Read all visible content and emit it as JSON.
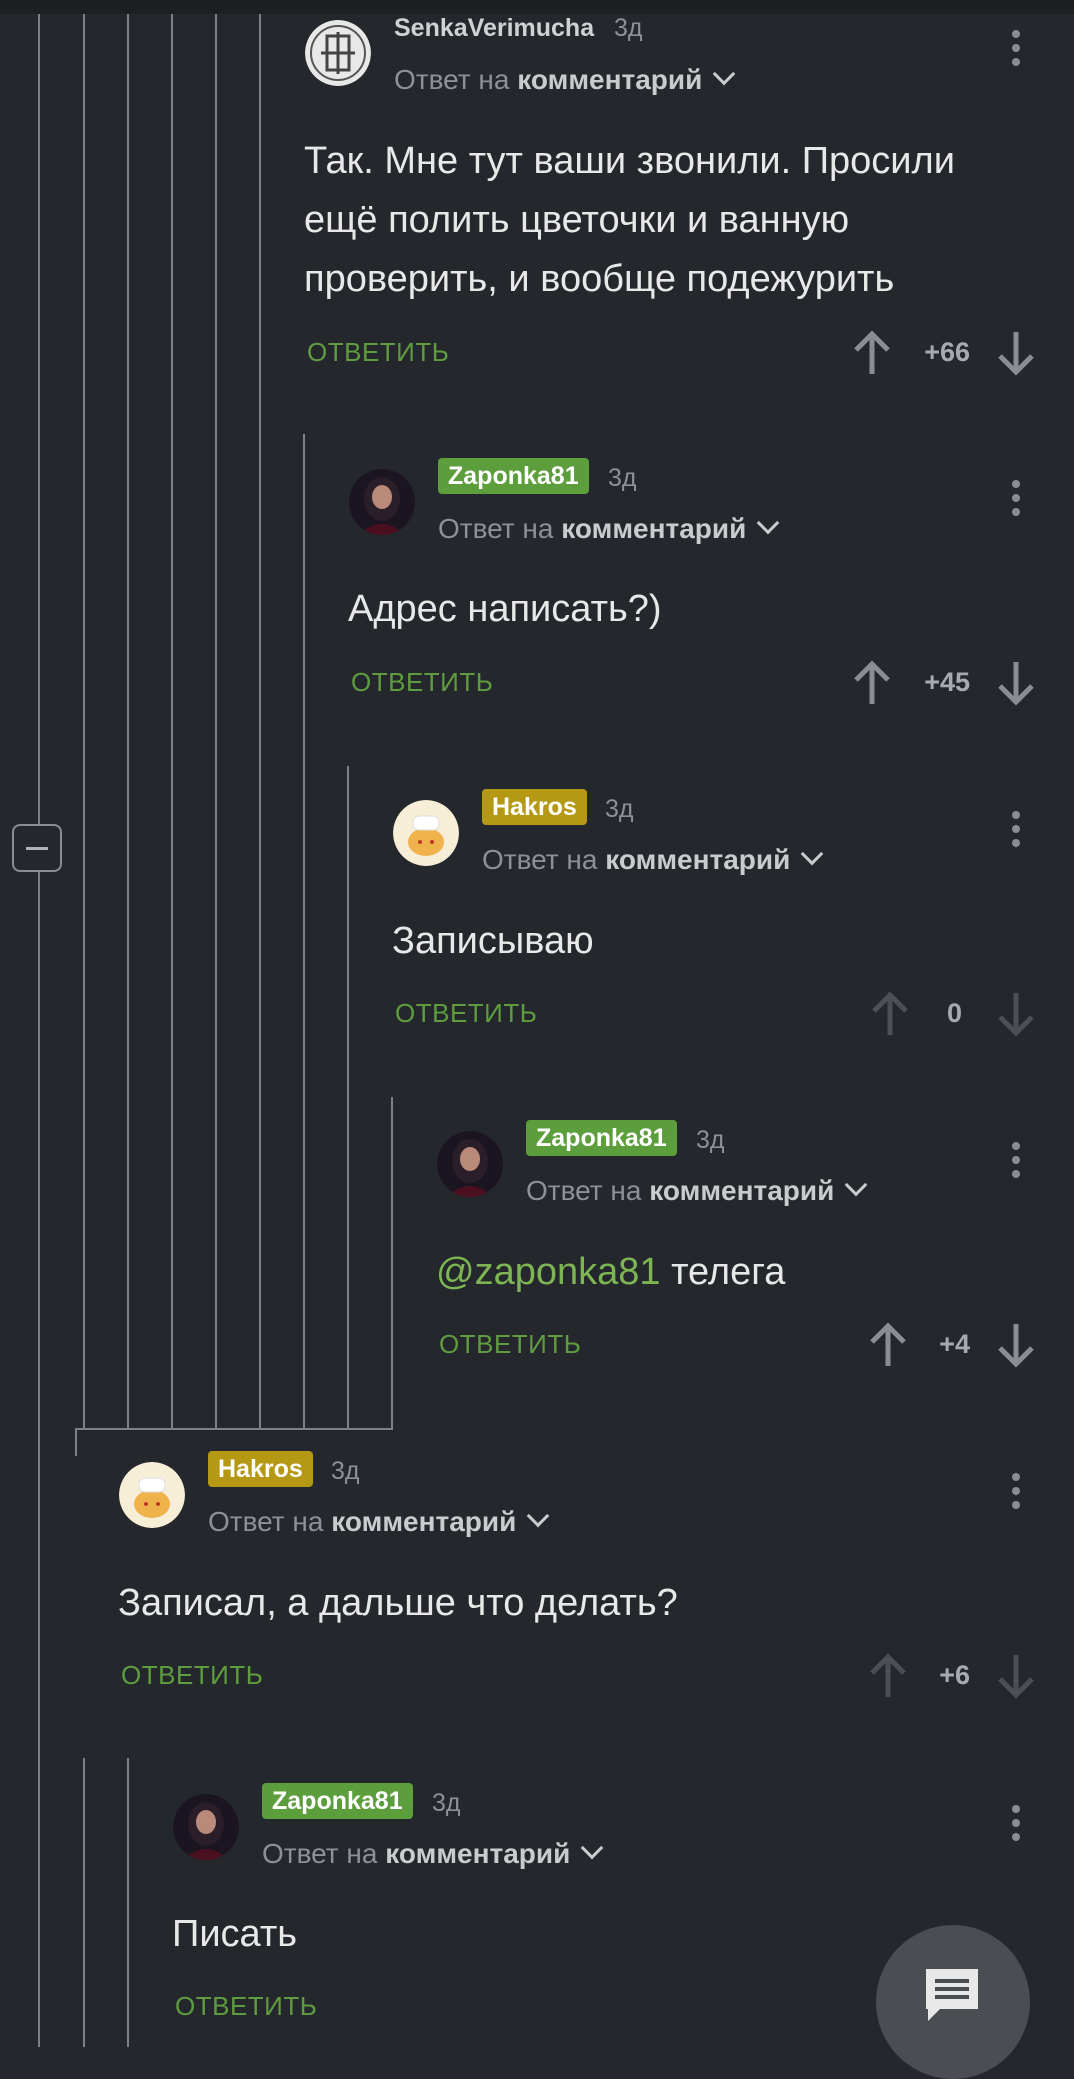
{
  "comments": [
    {
      "username": "SenkaVerimucha",
      "age": "3д",
      "reply_prefix": "Ответ на",
      "reply_target": "комментарий",
      "text": "Так. Мне тут ваши звонили. Просили ещё полить цветочки и ванную проверить, и вообще подежурить",
      "reply_label": "ОТВЕТИТЬ",
      "score": "+66"
    },
    {
      "username": "Zaponka81",
      "age": "3д",
      "reply_prefix": "Ответ на",
      "reply_target": "комментарий",
      "text": "Адрес написать?)",
      "reply_label": "ОТВЕТИТЬ",
      "score": "+45"
    },
    {
      "username": "Hakros",
      "age": "3д",
      "reply_prefix": "Ответ на",
      "reply_target": "комментарий",
      "text": "Записываю",
      "reply_label": "ОТВЕТИТЬ",
      "score": "0"
    },
    {
      "username": "Zaponka81",
      "age": "3д",
      "reply_prefix": "Ответ на",
      "reply_target": "комментарий",
      "mention": "@zaponka81",
      "text": " телега",
      "reply_label": "ОТВЕТИТЬ",
      "score": "+4"
    },
    {
      "username": "Hakros",
      "age": "3д",
      "reply_prefix": "Ответ на",
      "reply_target": "комментарий",
      "text": "Записал, а дальше что делать?",
      "reply_label": "ОТВЕТИТЬ",
      "score": "+6"
    },
    {
      "username": "Zaponka81",
      "age": "3д",
      "reply_prefix": "Ответ на",
      "reply_target": "комментарий",
      "text": "Писать",
      "reply_label": "ОТВЕТИТЬ"
    }
  ],
  "colors": {
    "background": "#24272b",
    "reply_green": "#5f9c3f",
    "badge_green": "#5c9e3c",
    "badge_gold": "#b59813"
  },
  "icons": [
    "kebab-menu-icon",
    "upvote-arrow-icon",
    "downvote-arrow-icon",
    "chevron-down-icon",
    "collapse-minus-icon",
    "chat-bubble-icon"
  ]
}
